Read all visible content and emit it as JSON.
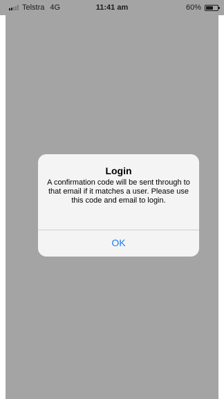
{
  "status_bar": {
    "carrier": "Telstra",
    "network": "4G",
    "time": "11:41 am",
    "battery_percent_label": "60%",
    "battery_level": 0.6,
    "signal_bars_total": 5,
    "signal_bars_filled": 2
  },
  "alert": {
    "title": "Login",
    "message": "A confirmation code will be sent through to that email if it matches a user. Please use this code and email to login.",
    "ok_label": "OK"
  },
  "colors": {
    "overlay": "#a4a4a4",
    "alert_background": "#f4f4f4",
    "button_text": "#1b7cf6"
  }
}
